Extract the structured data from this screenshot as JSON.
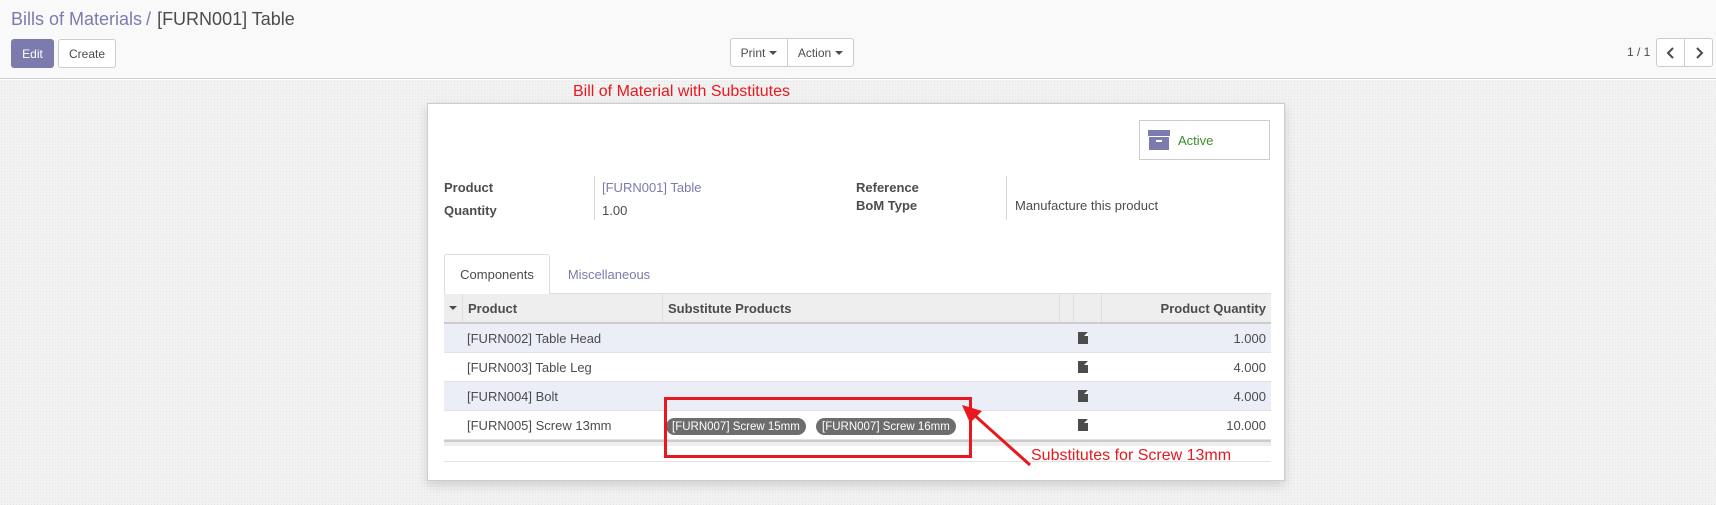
{
  "breadcrumb": {
    "parent": "Bills of Materials",
    "separator": "/",
    "current": "[FURN001] Table"
  },
  "buttons": {
    "edit": "Edit",
    "create": "Create",
    "print": "Print",
    "action": "Action"
  },
  "pager": {
    "value": "1 / 1",
    "prev_icon": "chevron-left-icon",
    "next_icon": "chevron-right-icon"
  },
  "status": {
    "label": "Active",
    "icon": "archive-icon",
    "color": "#3b8c2a"
  },
  "form": {
    "product_label": "Product",
    "product_value": "[FURN001] Table",
    "quantity_label": "Quantity",
    "quantity_value": "1.00",
    "reference_label": "Reference",
    "reference_value": "",
    "bom_type_label": "BoM Type",
    "bom_type_value": "Manufacture this product"
  },
  "tabs": [
    {
      "label": "Components",
      "active": true
    },
    {
      "label": "Miscellaneous",
      "active": false
    }
  ],
  "table": {
    "headers": {
      "product": "Product",
      "substitutes": "Substitute Products",
      "quantity": "Product Quantity"
    },
    "rows": [
      {
        "product": "[FURN002] Table Head",
        "substitutes": [],
        "quantity": "1.000"
      },
      {
        "product": "[FURN003] Table Leg",
        "substitutes": [],
        "quantity": "4.000"
      },
      {
        "product": "[FURN004] Bolt",
        "substitutes": [],
        "quantity": "4.000"
      },
      {
        "product": "[FURN005] Screw 13mm",
        "substitutes": [
          "[FURN007] Screw 15mm",
          "[FURN007] Screw 16mm"
        ],
        "quantity": "10.000"
      }
    ]
  },
  "annotations": {
    "title": "Bill of Material with Substitutes",
    "note": "Substitutes for Screw 13mm",
    "color": "#e8181e"
  },
  "colors": {
    "accent": "#7c7bad",
    "odd_row": "#ebedf7",
    "badge": "#6d6d6d"
  }
}
